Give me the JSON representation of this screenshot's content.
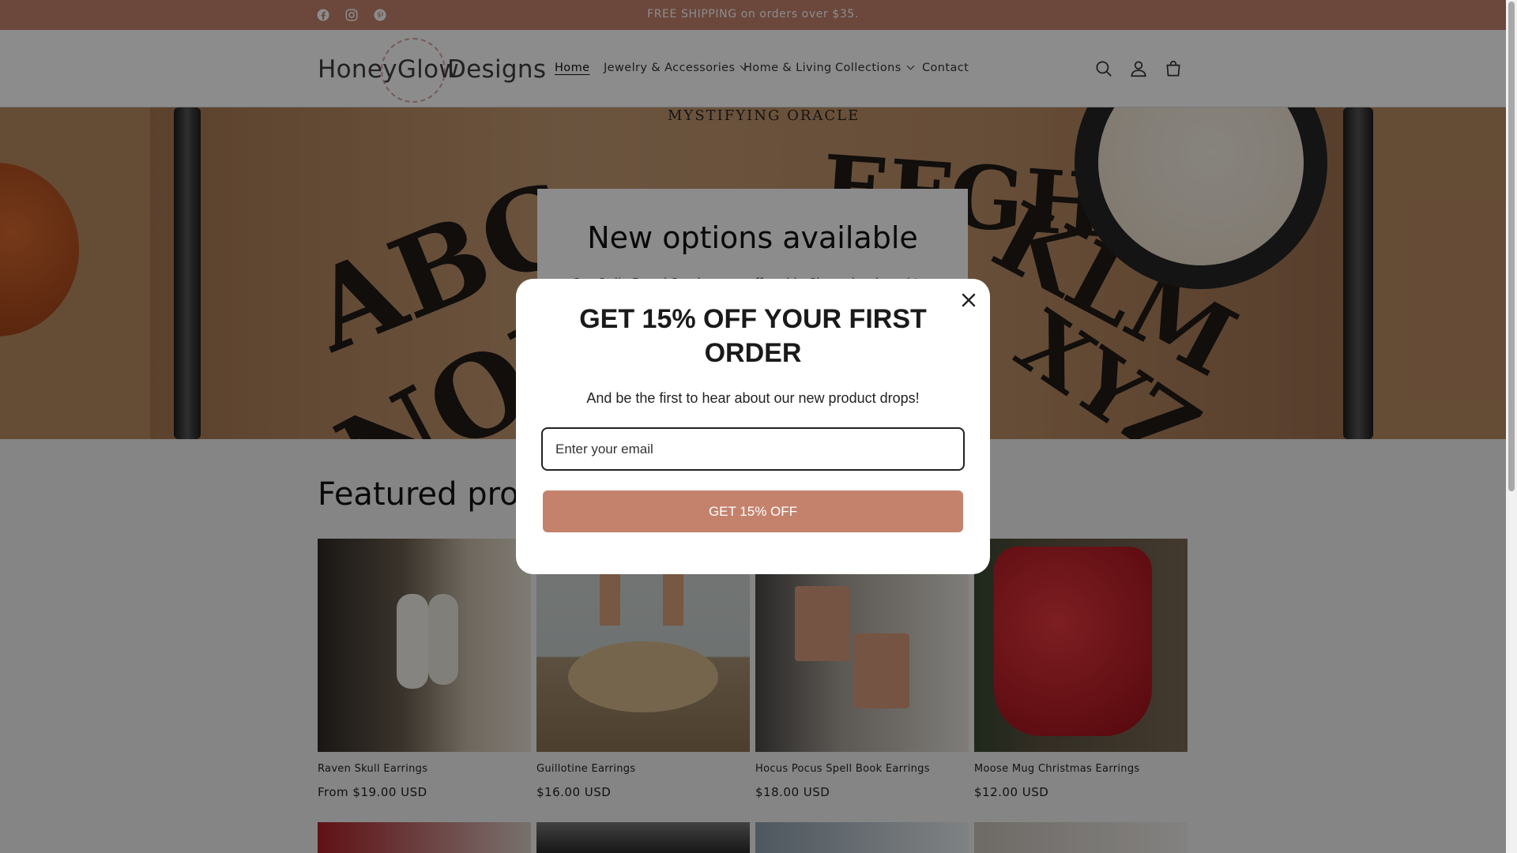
{
  "announcement": {
    "text": "FREE SHIPPING on orders over $35."
  },
  "social": [
    {
      "name": "facebook-icon"
    },
    {
      "name": "instagram-icon"
    },
    {
      "name": "pinterest-icon"
    }
  ],
  "logo": {
    "left": "HoneyGlow",
    "right": "Designs"
  },
  "nav": {
    "home": "Home",
    "jewelry": "Jewelry & Accessories",
    "home_living": "Home & Living",
    "collections": "Collections",
    "contact": "Contact"
  },
  "hero": {
    "title": "New options available",
    "subtitle": "Our Ouija Board Serving now offered in Cherry hardwood too",
    "oracle_text": "MYSTIFYING ORACLE"
  },
  "featured": {
    "title": "Featured products",
    "products": [
      {
        "name": "Raven Skull Earrings",
        "price": "From $19.00 USD"
      },
      {
        "name": "Guillotine Earrings",
        "price": "$16.00 USD"
      },
      {
        "name": "Hocus Pocus Spell Book Earrings",
        "price": "$18.00 USD"
      },
      {
        "name": "Moose Mug Christmas Earrings",
        "price": "$12.00 USD"
      }
    ]
  },
  "popup": {
    "heading": "GET 15% OFF YOUR FIRST ORDER",
    "text": "And be the first to hear about our new product drops!",
    "email_placeholder": "Enter your email",
    "button": "GET 15% OFF"
  },
  "colors": {
    "brand": "#c4826d",
    "overlay": "rgba(0,0,0,0.45)"
  }
}
